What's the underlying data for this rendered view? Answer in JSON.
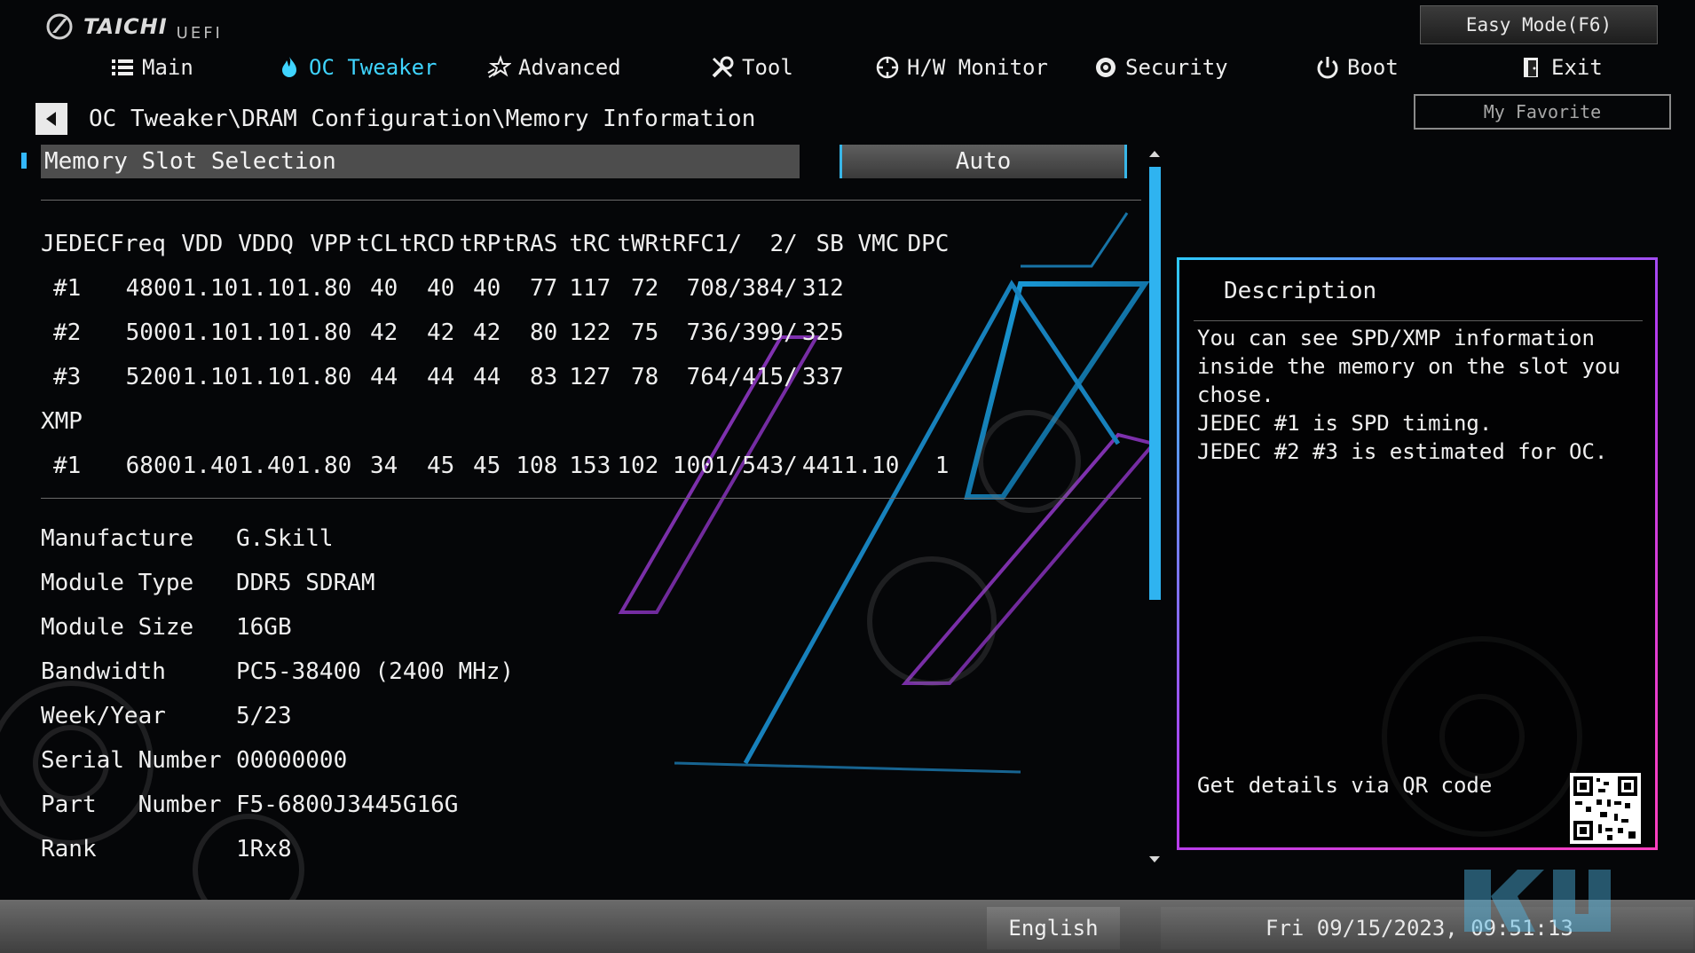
{
  "app": {
    "brand": "TAICHI",
    "sub": "UEFI"
  },
  "header": {
    "easy_mode": "Easy Mode(F6)",
    "my_favorite": "My Favorite"
  },
  "tabs": [
    {
      "label": "Main",
      "icon": "list-icon"
    },
    {
      "label": "OC Tweaker",
      "icon": "flame-icon",
      "active": true
    },
    {
      "label": "Advanced",
      "icon": "star-icon"
    },
    {
      "label": "Tool",
      "icon": "wrench-icon"
    },
    {
      "label": "H/W Monitor",
      "icon": "monitor-icon"
    },
    {
      "label": "Security",
      "icon": "shield-icon"
    },
    {
      "label": "Boot",
      "icon": "power-icon"
    },
    {
      "label": "Exit",
      "icon": "exit-door-icon"
    }
  ],
  "breadcrumb": "OC Tweaker\\DRAM Configuration\\Memory Information",
  "slot_selection": {
    "label": "Memory Slot Selection",
    "value": "Auto"
  },
  "spd": {
    "headers": [
      "JEDEC",
      "Freq",
      "VDD",
      "VDDQ",
      "VPP",
      "tCL",
      "tRCD",
      "tRP",
      "tRAS",
      "tRC",
      "tWR",
      "tRFC1/",
      "2/",
      "SB",
      "VMC",
      "DPC"
    ],
    "jedec_rows": [
      [
        "#1",
        "4800",
        "1.10",
        "1.10",
        "1.80",
        "40",
        "40",
        "40",
        "77",
        "117",
        "72",
        "708/",
        "384/",
        "312",
        "",
        ""
      ],
      [
        "#2",
        "5000",
        "1.10",
        "1.10",
        "1.80",
        "42",
        "42",
        "42",
        "80",
        "122",
        "75",
        "736/",
        "399/",
        "325",
        "",
        ""
      ],
      [
        "#3",
        "5200",
        "1.10",
        "1.10",
        "1.80",
        "44",
        "44",
        "44",
        "83",
        "127",
        "78",
        "764/",
        "415/",
        "337",
        "",
        ""
      ]
    ],
    "xmp_label": "XMP",
    "xmp_rows": [
      [
        "#1",
        "6800",
        "1.40",
        "1.40",
        "1.80",
        "34",
        "45",
        "45",
        "108",
        "153",
        "102",
        "1001/",
        "543/",
        "441",
        "1.10",
        "1"
      ]
    ]
  },
  "module_info": [
    {
      "label": "Manufacture",
      "value": "G.Skill"
    },
    {
      "label": "Module Type",
      "value": "DDR5 SDRAM"
    },
    {
      "label": "Module Size",
      "value": "16GB"
    },
    {
      "label": "Bandwidth",
      "value": "PC5-38400 (2400 MHz)"
    },
    {
      "label": "Week/Year",
      "value": "5/23"
    },
    {
      "label": "Serial Number",
      "value": "00000000"
    },
    {
      "label": "Part   Number",
      "value": "F5-6800J3445G16G"
    },
    {
      "label": "Rank",
      "value": "1Rx8"
    }
  ],
  "description": {
    "title": "Description",
    "text": "You can see SPD/XMP information\ninside the memory on the slot you\nchose.\nJEDEC #1 is SPD timing.\nJEDEC #2 #3 is estimated for OC.",
    "qr_label": "Get details via QR code"
  },
  "footer": {
    "language": "English",
    "datetime": "Fri 09/15/2023, 09:51:13"
  },
  "colors": {
    "accent": "#3fd4ff",
    "scrollbar": "#2fb3f0",
    "panel_border_start": "#2ec9ff",
    "panel_border_end": "#ff3fbf"
  }
}
